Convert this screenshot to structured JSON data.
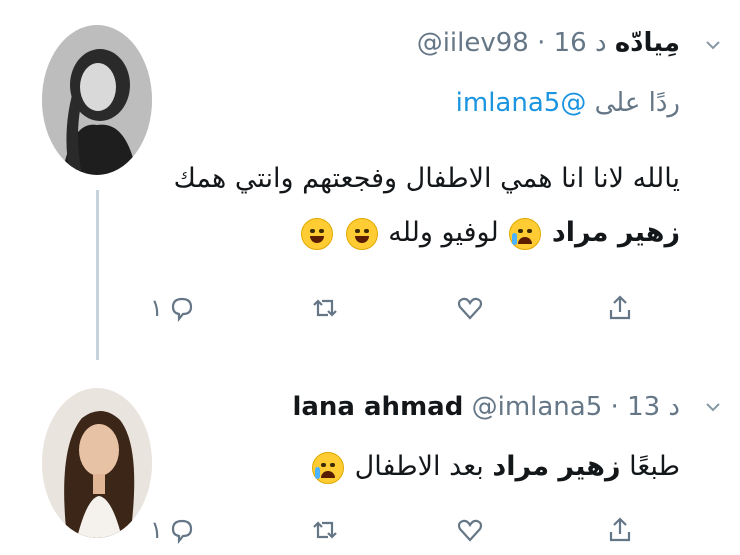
{
  "tweets": [
    {
      "display_name": "مِيادّه",
      "handle": "@iilev98",
      "separator": "·",
      "time": "16 د",
      "replying_prefix": "ردًا على",
      "replying_to": "@imlana5",
      "line1": "يالله لانا انا همي الاطفال وفجعتهم وانتي همك",
      "line2_bold": "زهير مراد",
      "line2_rest": "لوفيو ولله",
      "reply_count": "١",
      "icons": {
        "line1_end": "none",
        "line2": [
          "rolling-laughing-icon",
          "rolling-laughing-icon",
          "crying-icon"
        ]
      }
    },
    {
      "display_name": "lana ahmad",
      "handle": "@imlana5",
      "separator": "·",
      "time": "13 د",
      "text_start": "طبعًا",
      "text_bold": "زهير مراد",
      "text_end": "بعد الاطفال",
      "reply_count": "١",
      "icons": {
        "line_end": "tears-of-joy-icon"
      }
    }
  ],
  "colors": {
    "text": "#14171a",
    "muted": "#657786",
    "link": "#1b95e0",
    "thread": "#c8d2da"
  }
}
